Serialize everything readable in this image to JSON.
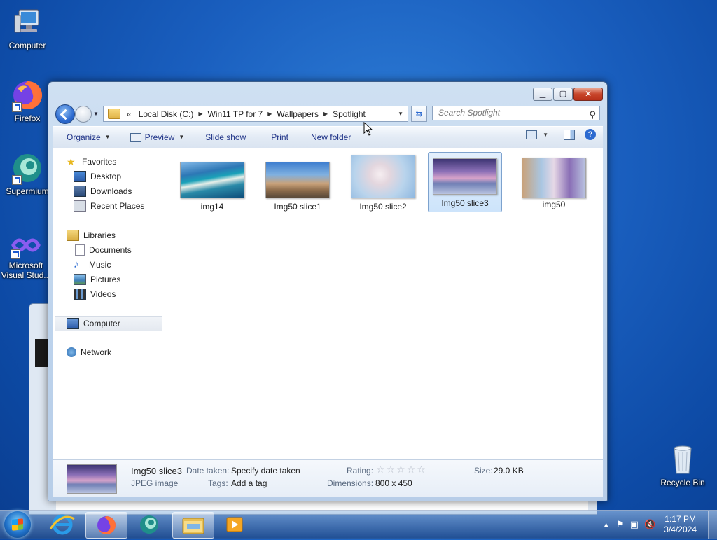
{
  "desktop": {
    "icons": [
      {
        "label": "Computer"
      },
      {
        "label": "Firefox"
      },
      {
        "label": "Supermium"
      },
      {
        "label": "Microsoft Visual Stud..."
      },
      {
        "label": "Recycle Bin"
      }
    ]
  },
  "window": {
    "address": {
      "overflow": "«",
      "crumbs": [
        "Local Disk (C:)",
        "Win11 TP for 7",
        "Wallpapers",
        "Spotlight"
      ]
    },
    "search_placeholder": "Search Spotlight",
    "toolbar": {
      "organize": "Organize",
      "preview": "Preview",
      "slideshow": "Slide show",
      "print": "Print",
      "new_folder": "New folder"
    },
    "nav": {
      "favorites": "Favorites",
      "desktop": "Desktop",
      "downloads": "Downloads",
      "recent": "Recent Places",
      "libraries": "Libraries",
      "documents": "Documents",
      "music": "Music",
      "pictures": "Pictures",
      "videos": "Videos",
      "computer": "Computer",
      "network": "Network"
    },
    "files": [
      {
        "name": "img14"
      },
      {
        "name": "Img50 slice1"
      },
      {
        "name": "Img50 slice2"
      },
      {
        "name": "Img50 slice3",
        "selected": true
      },
      {
        "name": "img50"
      }
    ],
    "details": {
      "name": "Img50 slice3",
      "type": "JPEG image",
      "date_label": "Date taken:",
      "date_value": "Specify date taken",
      "tags_label": "Tags:",
      "tags_value": "Add a tag",
      "rating_label": "Rating:",
      "rating_value": 0,
      "rating_max": 5,
      "dimensions_label": "Dimensions:",
      "dimensions_value": "800 x 450",
      "size_label": "Size:",
      "size_value": "29.0 KB"
    }
  },
  "taskbar": {
    "time": "1:17 PM",
    "date": "3/4/2024"
  },
  "colors": {
    "desktop": "#1a5fbf",
    "link_text": "#1e3287",
    "selection": "#cde4fb"
  }
}
